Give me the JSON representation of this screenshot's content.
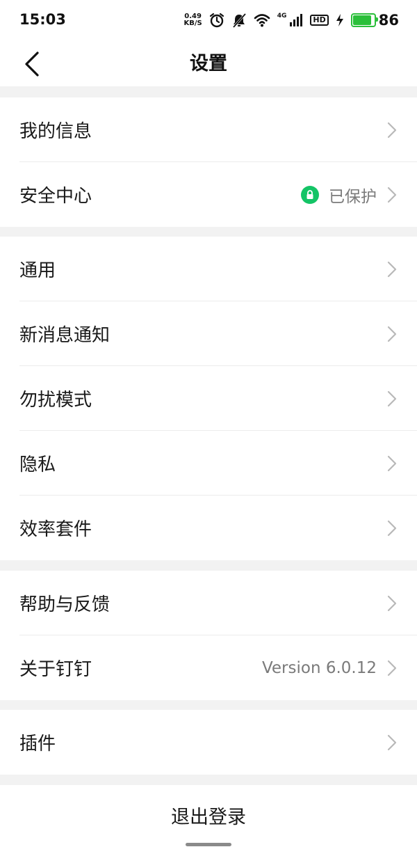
{
  "status_bar": {
    "time": "15:03",
    "net_speed_value": "0.49",
    "net_speed_unit": "KB/S",
    "signal_type": "4G",
    "hd_label": "HD",
    "battery_level": "86",
    "icons": [
      "alarm-icon",
      "mute-icon",
      "wifi-icon",
      "signal-icon",
      "hd-icon",
      "charging-icon",
      "battery-icon"
    ],
    "battery_color": "#2bbf3a"
  },
  "nav": {
    "title": "设置",
    "back_icon": "chevron-left-icon"
  },
  "groups": [
    {
      "items": [
        {
          "label": "我的信息"
        },
        {
          "label": "安全中心",
          "status": "已保护",
          "status_icon": "lock-icon",
          "status_color": "#14c466"
        }
      ]
    },
    {
      "items": [
        {
          "label": "通用"
        },
        {
          "label": "新消息通知"
        },
        {
          "label": "勿扰模式"
        },
        {
          "label": "隐私"
        },
        {
          "label": "效率套件"
        }
      ]
    },
    {
      "items": [
        {
          "label": "帮助与反馈"
        },
        {
          "label": "关于钉钉",
          "value": "Version 6.0.12"
        }
      ]
    },
    {
      "items": [
        {
          "label": "插件"
        }
      ]
    }
  ],
  "logout": {
    "label": "退出登录"
  }
}
